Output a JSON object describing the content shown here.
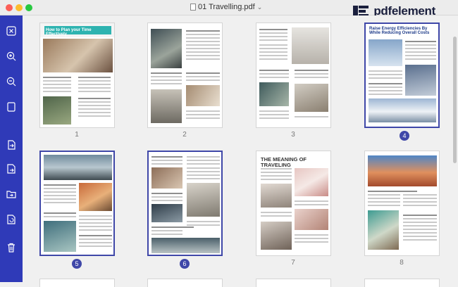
{
  "window": {
    "title": "01 Travelling.pdf"
  },
  "brand": {
    "name": "pdfelement"
  },
  "sidebar": {
    "items": [
      {
        "name": "close-icon"
      },
      {
        "name": "zoom-in-icon"
      },
      {
        "name": "zoom-out-icon"
      },
      {
        "name": "fit-page-icon"
      },
      {
        "name": "extract-pages-icon"
      },
      {
        "name": "insert-pages-icon"
      },
      {
        "name": "replace-pages-icon"
      },
      {
        "name": "rotate-pages-icon"
      },
      {
        "name": "delete-pages-icon"
      }
    ]
  },
  "pages": [
    {
      "number": "1",
      "selected": false,
      "heading": "How to Plan your Time Effectively"
    },
    {
      "number": "2",
      "selected": false
    },
    {
      "number": "3",
      "selected": false
    },
    {
      "number": "4",
      "selected": true,
      "heading": "Raise Energy Efficiencies By While Reducing Overall Costs"
    },
    {
      "number": "5",
      "selected": true
    },
    {
      "number": "6",
      "selected": true
    },
    {
      "number": "7",
      "selected": false,
      "heading": "THE MEANING OF TRAVELING"
    },
    {
      "number": "8",
      "selected": false
    }
  ],
  "colors": {
    "sidebar": "#2f3ab8",
    "selection": "#3f47a8",
    "brand_text": "#1a1f3d"
  }
}
